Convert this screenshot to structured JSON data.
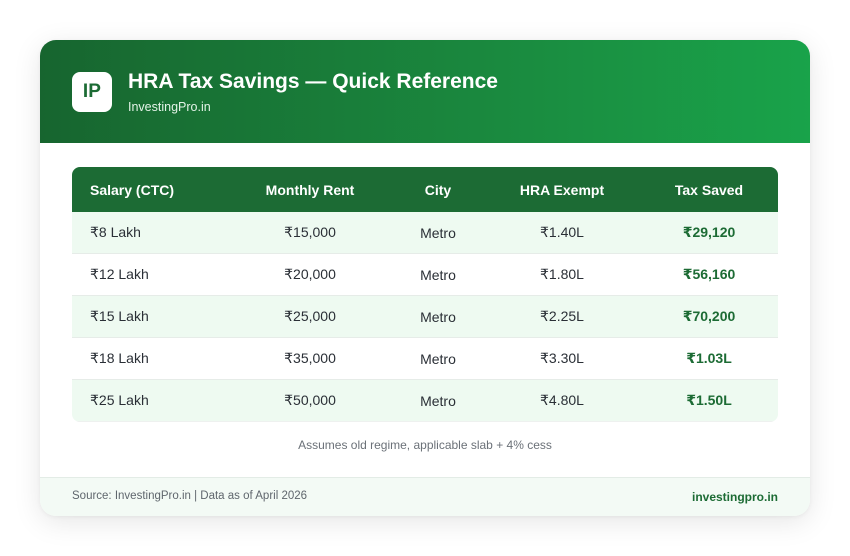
{
  "header": {
    "logo_text": "IP",
    "title": "HRA Tax Savings — Quick Reference",
    "subtitle": "InvestingPro.in"
  },
  "table": {
    "columns": [
      "Salary (CTC)",
      "Monthly Rent",
      "City",
      "HRA Exempt",
      "Tax Saved"
    ],
    "rows": [
      [
        "₹8 Lakh",
        "₹15,000",
        "Metro",
        "₹1.40L",
        "₹29,120"
      ],
      [
        "₹12 Lakh",
        "₹20,000",
        "Metro",
        "₹1.80L",
        "₹56,160"
      ],
      [
        "₹15 Lakh",
        "₹25,000",
        "Metro",
        "₹2.25L",
        "₹70,200"
      ],
      [
        "₹18 Lakh",
        "₹35,000",
        "Metro",
        "₹3.30L",
        "₹1.03L"
      ],
      [
        "₹25 Lakh",
        "₹50,000",
        "Metro",
        "₹4.80L",
        "₹1.50L"
      ]
    ]
  },
  "note": "Assumes old regime, applicable slab + 4% cess",
  "footer": {
    "source": "Source: InvestingPro.in | Data as of April 2026",
    "site": "investingpro.in"
  },
  "colors": {
    "brand_green": "#1c6b34",
    "header_gradient_end": "#19a34a",
    "row_tint": "#eefaf1"
  }
}
